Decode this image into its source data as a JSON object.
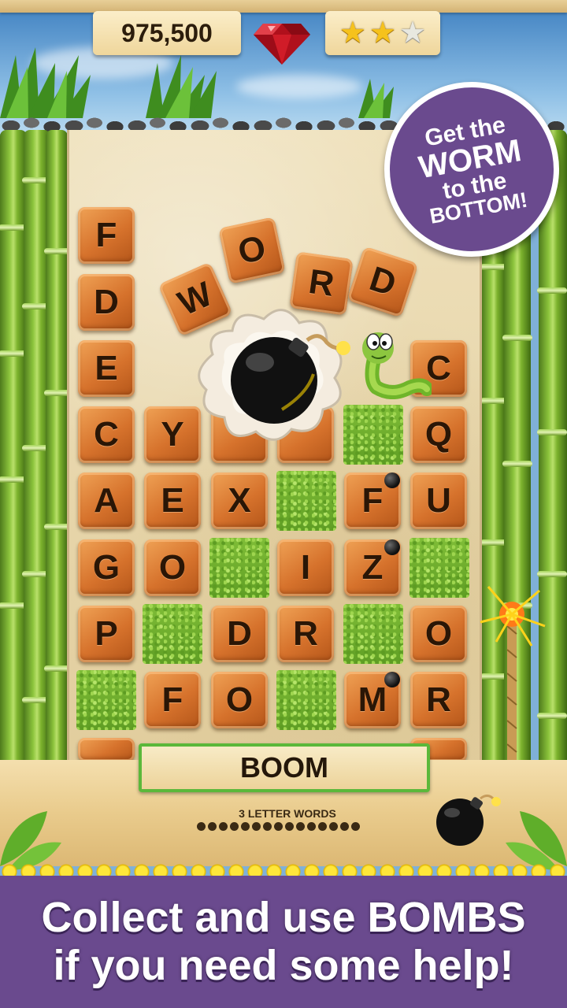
{
  "hud": {
    "score": "975,500",
    "stars_earned": 2,
    "stars_total": 3,
    "gem_icon": "red-gem-icon"
  },
  "callout": {
    "line1": "Get the",
    "line2": "WORM",
    "line3": "to the",
    "line4": "BOTTOM!"
  },
  "flying_word": [
    "W",
    "O",
    "R",
    "D"
  ],
  "board": {
    "rows": [
      [
        "F",
        "",
        "",
        "",
        "",
        ""
      ],
      [
        "D",
        "",
        "",
        "",
        "",
        ""
      ],
      [
        "E",
        "",
        "",
        "",
        "",
        "C"
      ],
      [
        "C",
        "Y",
        "",
        "",
        "",
        "Q"
      ],
      [
        "A",
        "E",
        "X",
        "",
        "F",
        "U"
      ],
      [
        "G",
        "O",
        "",
        "I",
        "Z",
        ""
      ],
      [
        "P",
        "",
        "D",
        "R",
        "",
        "O"
      ],
      [
        "",
        "F",
        "O",
        "",
        "M",
        "R"
      ]
    ]
  },
  "word_box": {
    "current_word": "BOOM"
  },
  "progress": {
    "label": "3 LETTER WORDS",
    "dots": 15
  },
  "banner": {
    "line1": "Collect and use BOMBS",
    "line2": "if you need some help!"
  },
  "colors": {
    "banner_purple": "#6a4a8e",
    "tile_orange": "#d6722c",
    "wordbox_border": "#5bb83a"
  }
}
